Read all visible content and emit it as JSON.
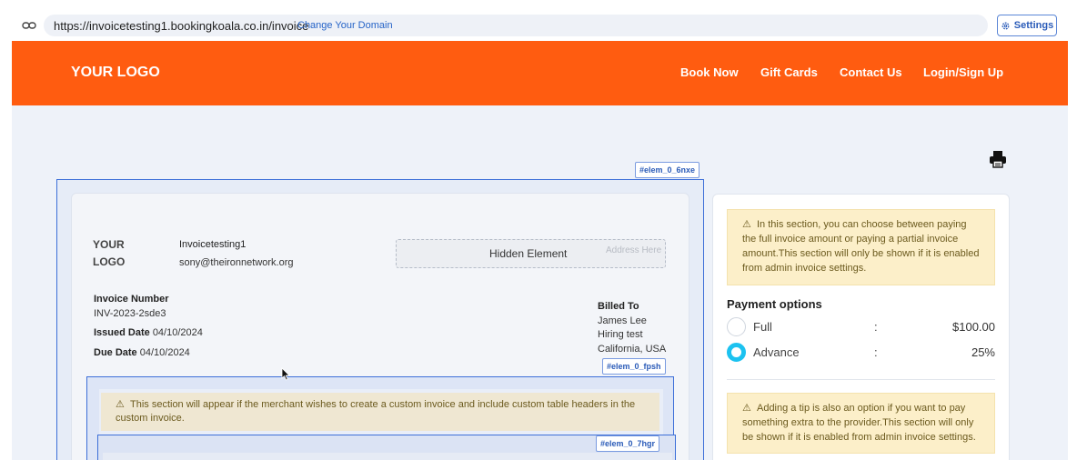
{
  "browser": {
    "url": "https://invoicetesting1.bookingkoala.co.in/invoice",
    "change_domain": "Change Your Domain",
    "settings_label": "Settings"
  },
  "header": {
    "logo": "YOUR LOGO",
    "nav": [
      "Book Now",
      "Gift Cards",
      "Contact Us",
      "Login/Sign Up"
    ],
    "accent_color": "#ff5c10"
  },
  "tags": {
    "outer": "#elem_0_6nxe",
    "table": "#elem_0_fpsh",
    "inner": "#elem_0_7hgr"
  },
  "invoice": {
    "logo_line1": "YOUR",
    "logo_line2": "LOGO",
    "company_name": "Invoicetesting1",
    "company_email": "sony@theironnetwork.org",
    "hidden_element": "Hidden Element",
    "address_placeholder": "Address Here",
    "number_label": "Invoice Number",
    "number": "INV-2023-2sde3",
    "issued_label": "Issued Date",
    "issued_date": "04/10/2024",
    "due_label": "Due Date",
    "due_date": "04/10/2024",
    "billed_to_label": "Billed To",
    "billed_name": "James Lee",
    "billed_company": "Hiring test",
    "billed_location": "California, USA",
    "custom_table_notice": "This section will appear if the merchant wishes to create a custom invoice and include custom table headers in the custom invoice."
  },
  "payment": {
    "notice": "In this section, you can choose between paying the full invoice amount or paying a partial invoice amount.This section will only be shown if it is enabled from admin invoice settings.",
    "title": "Payment options",
    "options": [
      {
        "label": "Full",
        "colon": ":",
        "value": "$100.00",
        "selected": false
      },
      {
        "label": "Advance",
        "colon": ":",
        "value": "25%",
        "selected": true
      }
    ],
    "tip_notice": "Adding a tip is also an option if you want to pay something extra to the provider.This section will only be shown if it is enabled from admin invoice settings."
  },
  "colors": {
    "selection_outline": "#3d6fd8",
    "radio_selected": "#1cc2f0",
    "warning_bg": "#fcefc9"
  }
}
